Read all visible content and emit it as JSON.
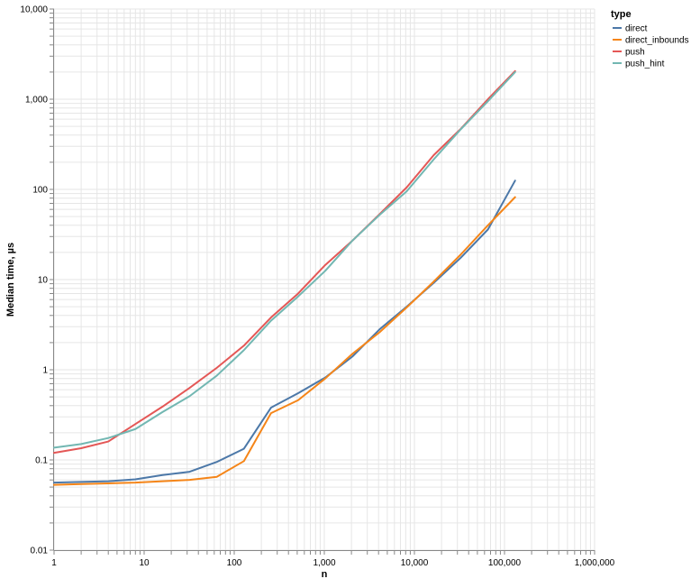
{
  "chart_data": {
    "type": "line",
    "xlabel": "n",
    "ylabel": "Median time, µs",
    "x_scale": "log",
    "y_scale": "log",
    "xlim": [
      1,
      1000000
    ],
    "ylim": [
      0.01,
      10000
    ],
    "grid": true,
    "legend_title": "type",
    "legend_position": "top-right",
    "x_ticks": [
      {
        "value": 1,
        "label": "1"
      },
      {
        "value": 10,
        "label": "10"
      },
      {
        "value": 100,
        "label": "100"
      },
      {
        "value": 1000,
        "label": "1,000"
      },
      {
        "value": 10000,
        "label": "10,000"
      },
      {
        "value": 100000,
        "label": "100,000"
      },
      {
        "value": 1000000,
        "label": "1,000,000"
      }
    ],
    "y_ticks": [
      {
        "value": 0.01,
        "label": "0.01"
      },
      {
        "value": 0.1,
        "label": "0.1"
      },
      {
        "value": 1,
        "label": "1"
      },
      {
        "value": 10,
        "label": "10"
      },
      {
        "value": 100,
        "label": "100"
      },
      {
        "value": 1000,
        "label": "1,000"
      },
      {
        "value": 10000,
        "label": "10,000"
      }
    ],
    "x": [
      1,
      2,
      4,
      8,
      16,
      32,
      64,
      128,
      256,
      512,
      1024,
      2048,
      4096,
      8192,
      16384,
      32768,
      65536,
      131072
    ],
    "series": [
      {
        "name": "direct",
        "color": "#4c78a8",
        "values": [
          0.056,
          0.057,
          0.058,
          0.061,
          0.068,
          0.074,
          0.095,
          0.133,
          0.38,
          0.55,
          0.82,
          1.4,
          2.8,
          5.0,
          9.2,
          17.5,
          36.0,
          125.0
        ]
      },
      {
        "name": "direct_inbounds",
        "color": "#f58518",
        "values": [
          0.053,
          0.054,
          0.055,
          0.056,
          0.058,
          0.06,
          0.065,
          0.097,
          0.33,
          0.46,
          0.8,
          1.5,
          2.6,
          4.9,
          9.5,
          19.0,
          40.0,
          82.0
        ]
      },
      {
        "name": "push",
        "color": "#e45756",
        "values": [
          0.12,
          0.135,
          0.16,
          0.25,
          0.39,
          0.63,
          1.05,
          1.85,
          3.8,
          7.0,
          14.5,
          27.0,
          53.0,
          105.0,
          240.0,
          470.0,
          1000.0,
          2050.0
        ]
      },
      {
        "name": "push_hint",
        "color": "#72b7b2",
        "values": [
          0.137,
          0.15,
          0.175,
          0.22,
          0.34,
          0.51,
          0.86,
          1.65,
          3.5,
          6.5,
          12.5,
          27.0,
          52.0,
          95.0,
          215.0,
          465.0,
          950.0,
          2000.0
        ]
      }
    ]
  }
}
